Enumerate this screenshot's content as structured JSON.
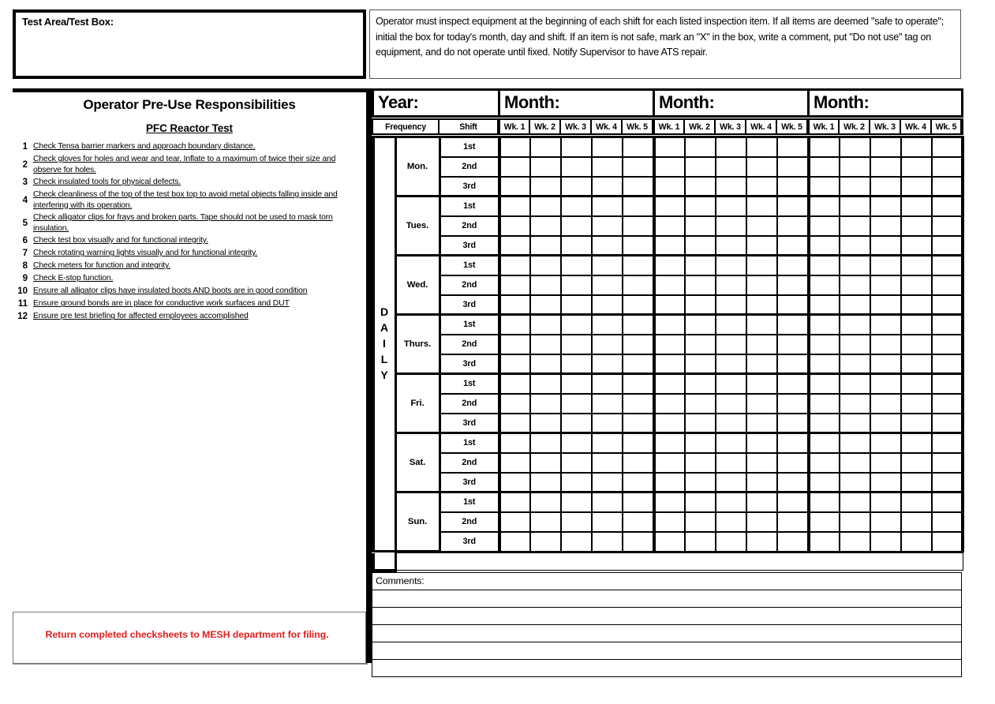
{
  "header": {
    "test_area_label": "Test Area/Test Box:",
    "instructions": "Operator must inspect equipment at the beginning of each shift for each listed inspection item.  If all items are deemed \"safe to operate\"; initial the box for today's month, day and shift.  If an item is not safe, mark an \"X\" in the box, write a comment, put \"Do not use\" tag on equipment,  and do not operate until fixed. Notify Supervisor to have ATS repair."
  },
  "left_panel": {
    "title": "Operator Pre-Use Responsibilities",
    "subtitle": "PFC Reactor Test",
    "items": [
      {
        "num": "1",
        "text": "Check Tensa barrier markers and approach boundary distance."
      },
      {
        "num": "2",
        "text": "Check gloves for holes and wear and tear.  Inflate to a maximum of twice their size and observe for holes."
      },
      {
        "num": "3",
        "text": "Check insulated tools for physical defects."
      },
      {
        "num": "4",
        "text": "Check cleanliness of the top of the test box top to avoid metal objects falling inside and interfering with its operation."
      },
      {
        "num": "5",
        "text": "Check alligator clips for frays and broken parts.  Tape should not be used to mask torn insulation."
      },
      {
        "num": "6",
        "text": "Check test box visually and for functional integrity."
      },
      {
        "num": "7",
        "text": "Check rotating warning lights visually and for functional integrity."
      },
      {
        "num": "8",
        "text": "Check meters for function and integrity."
      },
      {
        "num": "9",
        "text": "Check E-stop function."
      },
      {
        "num": "10",
        "text": "Ensure all alligator clips have insulated boots AND boots are in good condition"
      },
      {
        "num": "11",
        "text": "Ensure ground bonds are in place for conductive work surfaces and DUT"
      },
      {
        "num": "12",
        "text": "Ensure pre test briefing for affected employees accomplished"
      }
    ],
    "footer_note": "Return completed checksheets to MESH department for filing.",
    "footer_note_color": "#e02020"
  },
  "grid": {
    "year_label": "Year:",
    "month_label": "Month:",
    "month_count": 3,
    "frequency_label": "Frequency",
    "shift_label": "Shift",
    "week_labels": [
      "Wk. 1",
      "Wk. 2",
      "Wk. 3",
      "Wk. 4",
      "Wk. 5"
    ],
    "frequency_group": "DAILY",
    "frequency_group_letters": [
      "D",
      "A",
      "I",
      "L",
      "Y"
    ],
    "days": [
      "Mon.",
      "Tues.",
      "Wed.",
      "Thurs.",
      "Fri.",
      "Sat.",
      "Sun."
    ],
    "shifts": [
      "1st",
      "2nd",
      "3rd"
    ],
    "comments_label": "Comments:",
    "comment_blank_lines": 5
  }
}
